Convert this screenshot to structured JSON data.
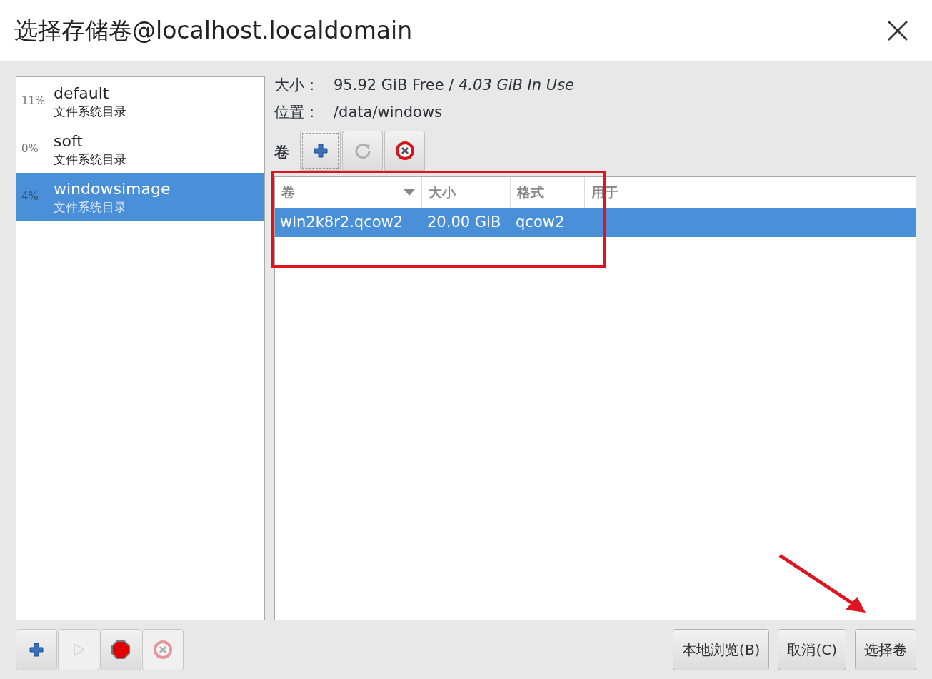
{
  "window": {
    "title": "选择存储卷@localhost.localdomain"
  },
  "pools": [
    {
      "usage": "11%",
      "name": "default",
      "type": "文件系统目录",
      "selected": false
    },
    {
      "usage": "0%",
      "name": "soft",
      "type": "文件系统目录",
      "selected": false
    },
    {
      "usage": "4%",
      "name": "windowsimage",
      "type": "文件系统目录",
      "selected": true
    }
  ],
  "details": {
    "size_label": "大小：",
    "size_free": "95.92 GiB Free",
    "size_separator": "/",
    "size_in_use": "4.03 GiB In Use",
    "location_label": "位置：",
    "location": "/data/windows"
  },
  "volumes_label": "卷",
  "volume_toolbar": [
    {
      "kind": "add",
      "disabled": false,
      "focused": true
    },
    {
      "kind": "refresh",
      "disabled": false,
      "focused": false
    },
    {
      "kind": "delete",
      "disabled": false,
      "focused": false
    }
  ],
  "table": {
    "columns": [
      {
        "label": "卷",
        "sorted": true
      },
      {
        "label": "大小",
        "sorted": false
      },
      {
        "label": "格式",
        "sorted": false
      },
      {
        "label": "用于",
        "sorted": false
      }
    ],
    "rows": [
      {
        "cells": [
          "win2k8r2.qcow2",
          "20.00 GiB",
          "qcow2"
        ],
        "selected": true
      }
    ]
  },
  "pool_toolbar": [
    {
      "kind": "add",
      "disabled": false
    },
    {
      "kind": "start",
      "disabled": true
    },
    {
      "kind": "stop",
      "disabled": false
    },
    {
      "kind": "delete",
      "disabled": true
    }
  ],
  "buttons": [
    "本地浏览(B)",
    "取消(C)",
    "选择卷"
  ]
}
